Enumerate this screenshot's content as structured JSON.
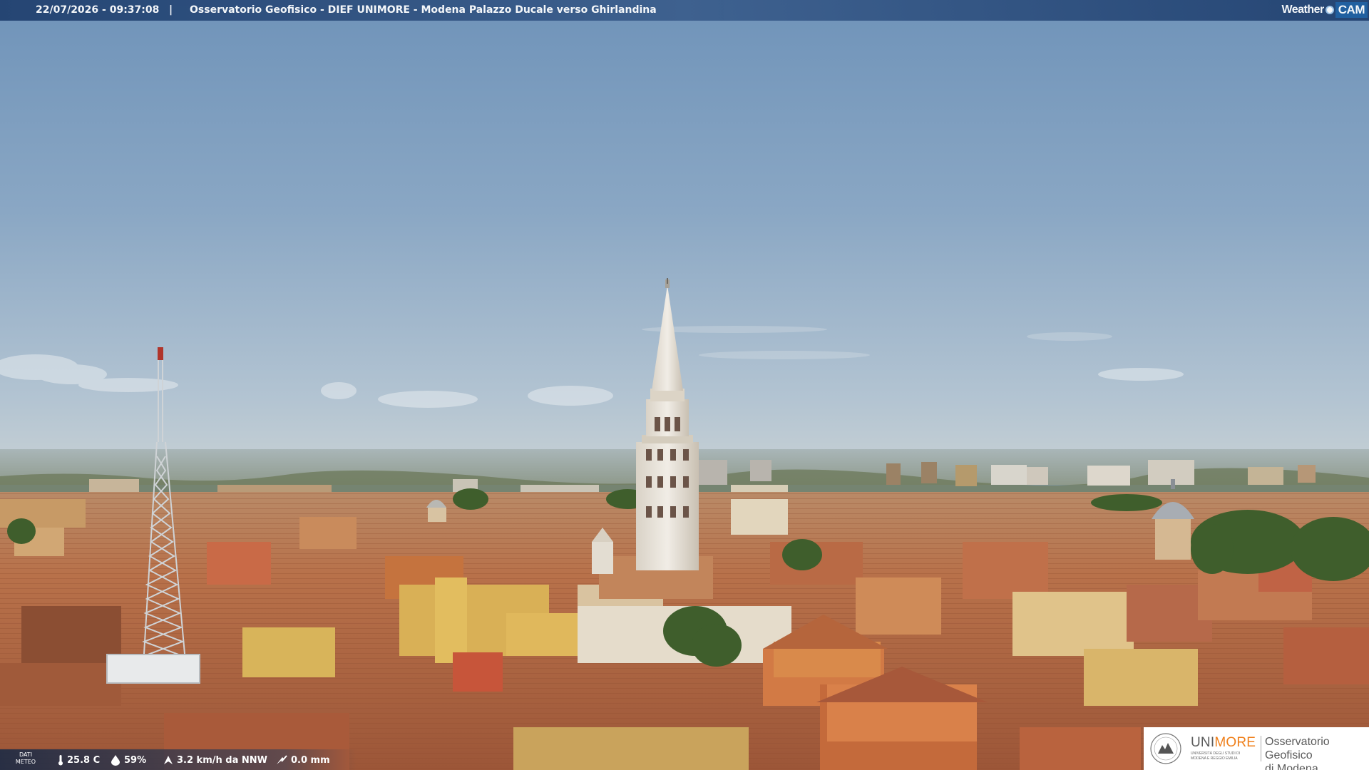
{
  "header": {
    "timestamp": "22/07/2026 - 09:37:08",
    "separator": "|",
    "title": "Osservatorio Geofisico - DIEF UNIMORE - Modena Palazzo Ducale verso Ghirlandina",
    "brand_word": "Weather",
    "brand_cam": "CAM"
  },
  "weather": {
    "label_line1": "DATI",
    "label_line2": "METEO",
    "temperature": "25.8 C",
    "humidity": "59%",
    "wind": "3.2 km/h da NNW",
    "rain": "0.0 mm",
    "icons": [
      "thermometer-icon",
      "humidity-drop-icon",
      "wind-icon",
      "rain-icon"
    ]
  },
  "logo": {
    "uni_prefix": "UNI",
    "uni_suffix": "MORE",
    "uni_sub": "UNIVERSITÀ DEGLI STUDI DI MODENA E REGGIO EMILIA",
    "observatory_line1": "Osservatorio Geofisico",
    "observatory_line2": "di Modena"
  },
  "colors": {
    "sky_top": "#7b9dc0",
    "sky_bottom": "#b9c9d6",
    "roof": "#b8693f",
    "tower": "#e9e4dc",
    "unimore_orange": "#ef7f1a"
  }
}
